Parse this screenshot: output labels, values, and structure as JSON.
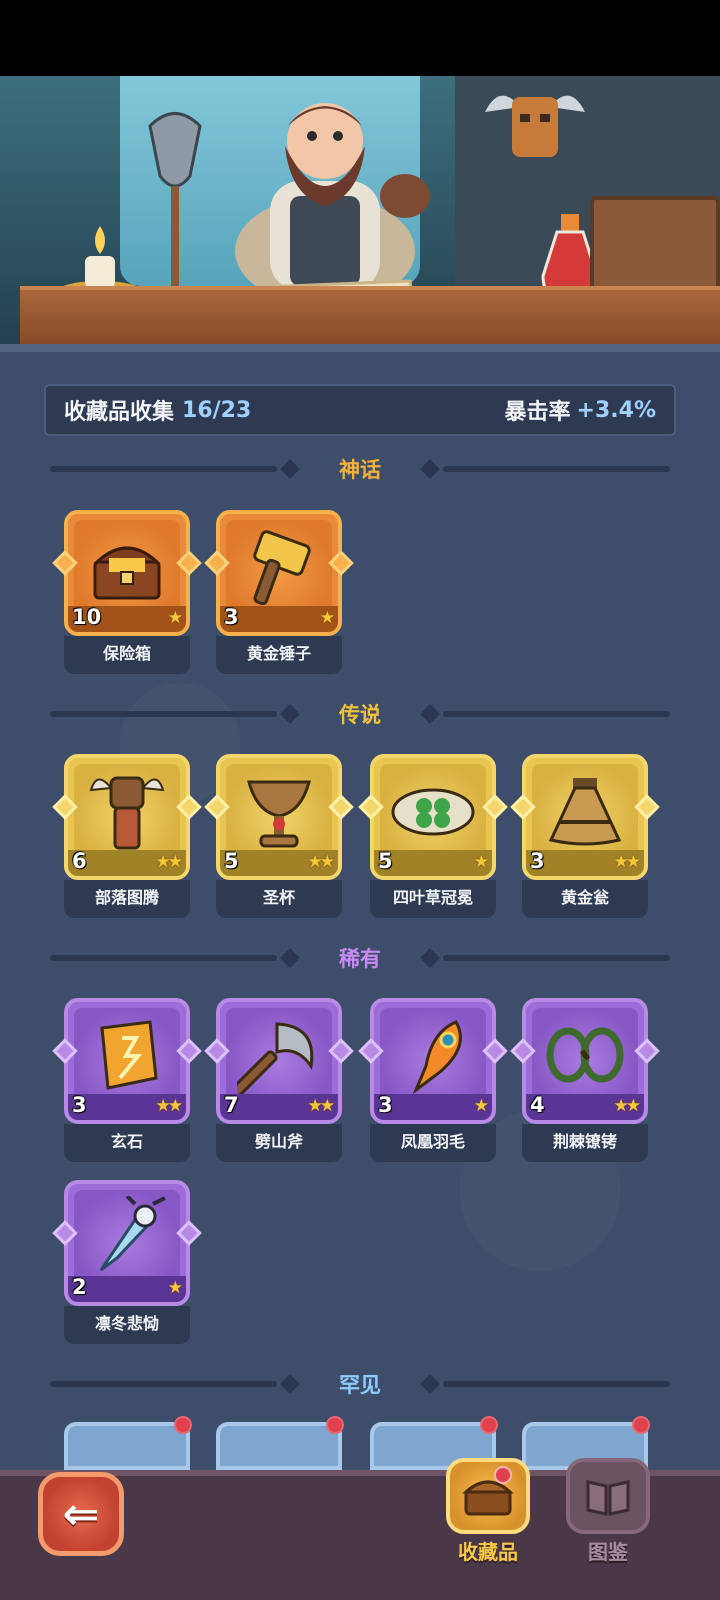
{
  "collection": {
    "label": "收藏品收集",
    "progress": "16/23",
    "stat_label": "暴击率",
    "stat_value": "+3.4%"
  },
  "sections": {
    "mythic": "神话",
    "legendary": "传说",
    "rare": "稀有",
    "uncommon": "罕见"
  },
  "mythic_items": [
    {
      "name": "保险箱",
      "count": "10",
      "stars": 1,
      "icon": "treasure-chest-icon"
    },
    {
      "name": "黄金锤子",
      "count": "3",
      "stars": 1,
      "icon": "golden-hammer-icon"
    }
  ],
  "legendary_items": [
    {
      "name": "部落图腾",
      "count": "6",
      "stars": 2,
      "icon": "totem-icon"
    },
    {
      "name": "圣杯",
      "count": "5",
      "stars": 2,
      "icon": "grail-icon"
    },
    {
      "name": "四叶草冠冕",
      "count": "5",
      "stars": 1,
      "icon": "clover-crown-icon"
    },
    {
      "name": "黄金瓮",
      "count": "3",
      "stars": 2,
      "icon": "golden-urn-icon"
    }
  ],
  "rare_items": [
    {
      "name": "玄石",
      "count": "3",
      "stars": 2,
      "icon": "mystic-stone-icon"
    },
    {
      "name": "劈山斧",
      "count": "7",
      "stars": 2,
      "icon": "axe-icon"
    },
    {
      "name": "凤凰羽毛",
      "count": "3",
      "stars": 1,
      "icon": "phoenix-feather-icon"
    },
    {
      "name": "荆棘镣铐",
      "count": "4",
      "stars": 2,
      "icon": "thorn-shackles-icon"
    },
    {
      "name": "凛冬悲恸",
      "count": "2",
      "stars": 1,
      "icon": "frost-dagger-icon"
    }
  ],
  "nav": {
    "back": "back-arrow-icon",
    "collection_tab": "收藏品",
    "codex_tab": "图鉴"
  },
  "colors": {
    "background": "#3e4d69",
    "mythic": "#e98a3a",
    "legendary": "#e8c450",
    "rare": "#9c6cd8",
    "uncommon": "#7fa6cf",
    "notification": "#e0414d"
  }
}
